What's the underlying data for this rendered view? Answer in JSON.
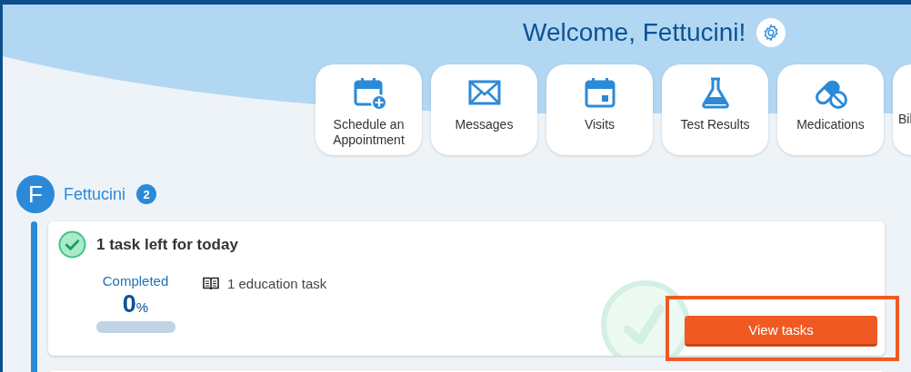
{
  "header": {
    "title": "Welcome, Fettucini!"
  },
  "shortcuts": [
    {
      "kind": "schedule",
      "label": "Schedule an Appointment"
    },
    {
      "kind": "messages",
      "label": "Messages"
    },
    {
      "kind": "visits",
      "label": "Visits"
    },
    {
      "kind": "results",
      "label": "Test Results"
    },
    {
      "kind": "medications",
      "label": "Medications"
    },
    {
      "kind": "cut",
      "label": "Bil"
    }
  ],
  "patient": {
    "initial": "F",
    "name": "Fettucini",
    "badge": "2"
  },
  "task_card": {
    "title": "1 task left for today",
    "completed_label": "Completed",
    "percent": "0",
    "percent_unit": "%",
    "level": 0,
    "tasks": [
      {
        "kind": "education",
        "label": "1 education task"
      }
    ],
    "button": "View tasks",
    "highlighted": true
  }
}
